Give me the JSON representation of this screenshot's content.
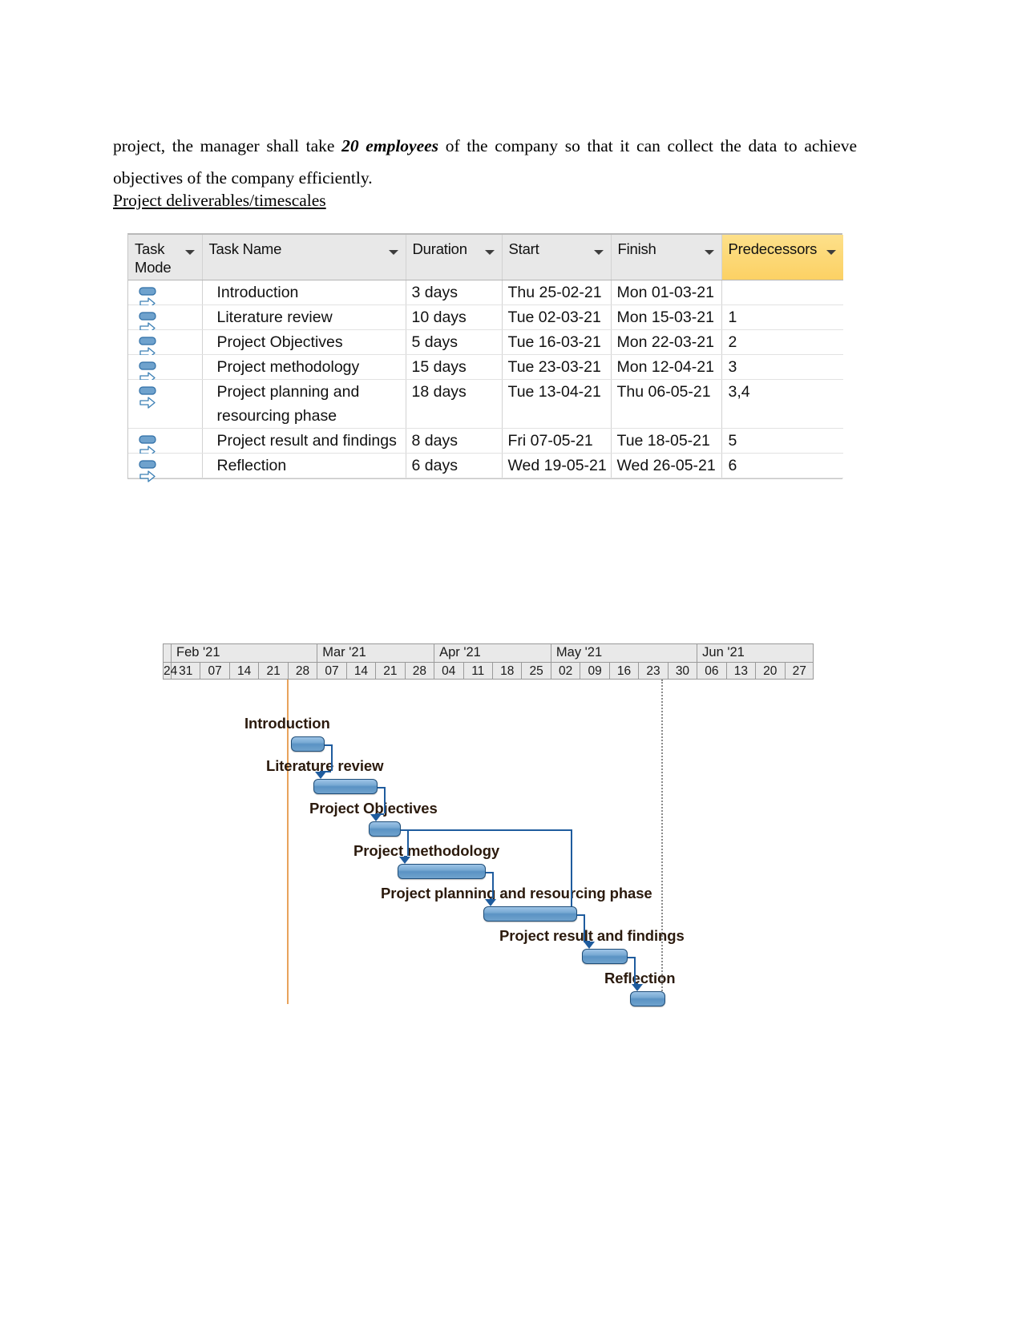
{
  "document": {
    "paragraph_prefix": "project, the manager shall take ",
    "paragraph_bold": "20 employees",
    "paragraph_suffix": " of the company so that it can collect the data to achieve objectives of the company efficiently.",
    "heading": "Project deliverables/timescales"
  },
  "table": {
    "columns": [
      {
        "label": "Task Mode",
        "icon": "chevron-down-icon",
        "highlighted": false
      },
      {
        "label": "Task Name",
        "icon": "chevron-down-icon",
        "highlighted": false
      },
      {
        "label": "Duration",
        "icon": "chevron-down-icon",
        "highlighted": false
      },
      {
        "label": "Start",
        "icon": "chevron-down-icon",
        "highlighted": false
      },
      {
        "label": "Finish",
        "icon": "chevron-down-icon",
        "highlighted": false
      },
      {
        "label": "Predecessors",
        "icon": "chevron-down-icon",
        "highlighted": true
      }
    ],
    "highlight_color": "#fcd164",
    "header_background": "#e8e8e8",
    "rows": [
      {
        "mode_icon": "auto-schedule-icon",
        "name": "Introduction",
        "duration": "3 days",
        "start": "Thu 25-02-21",
        "finish": "Mon 01-03-21",
        "predecessors": ""
      },
      {
        "mode_icon": "auto-schedule-icon",
        "name": "Literature review",
        "duration": "10 days",
        "start": "Tue 02-03-21",
        "finish": "Mon 15-03-21",
        "predecessors": "1"
      },
      {
        "mode_icon": "auto-schedule-icon",
        "name": "Project Objectives",
        "duration": "5 days",
        "start": "Tue 16-03-21",
        "finish": "Mon 22-03-21",
        "predecessors": "2"
      },
      {
        "mode_icon": "auto-schedule-icon",
        "name": "Project methodology",
        "duration": "15 days",
        "start": "Tue 23-03-21",
        "finish": "Mon 12-04-21",
        "predecessors": "3"
      },
      {
        "mode_icon": "auto-schedule-icon",
        "name": "Project planning and resourcing phase",
        "duration": "18 days",
        "start": "Tue 13-04-21",
        "finish": "Thu 06-05-21",
        "predecessors": "3,4"
      },
      {
        "mode_icon": "auto-schedule-icon",
        "name": "Project result and findings",
        "duration": "8 days",
        "start": "Fri 07-05-21",
        "finish": "Tue 18-05-21",
        "predecessors": "5"
      },
      {
        "mode_icon": "auto-schedule-icon",
        "name": "Reflection",
        "duration": "6 days",
        "start": "Wed 19-05-21",
        "finish": "Wed 26-05-21",
        "predecessors": "6"
      }
    ]
  },
  "chart_data": {
    "type": "bar",
    "chart_kind": "gantt",
    "title": "Project deliverables/timescales",
    "xlabel": "",
    "ylabel": "",
    "grid": false,
    "legend": "none",
    "bar_color": "#6fa2cd",
    "bar_outline_color": "#1f4e79",
    "today_line_color": "#e8a35c",
    "months": [
      "Feb '21",
      "Mar '21",
      "Apr '21",
      "May '21",
      "Jun '21"
    ],
    "month_spans": [
      5,
      4,
      4,
      5,
      4
    ],
    "week_ticks": [
      "24",
      "31",
      "07",
      "14",
      "21",
      "28",
      "07",
      "14",
      "21",
      "28",
      "04",
      "11",
      "18",
      "25",
      "02",
      "09",
      "16",
      "23",
      "30",
      "06",
      "13",
      "20",
      "27"
    ],
    "categories": [
      "Introduction",
      "Literature review",
      "Project Objectives",
      "Project methodology",
      "Project planning and resourcing phase",
      "Project result and findings",
      "Reflection"
    ],
    "tasks": [
      {
        "name": "Introduction",
        "start": "Thu 25-02-21",
        "finish": "Mon 01-03-21",
        "duration_days": 3,
        "predecessors": ""
      },
      {
        "name": "Literature review",
        "start": "Tue 02-03-21",
        "finish": "Mon 15-03-21",
        "duration_days": 10,
        "predecessors": "1"
      },
      {
        "name": "Project Objectives",
        "start": "Tue 16-03-21",
        "finish": "Mon 22-03-21",
        "duration_days": 5,
        "predecessors": "2"
      },
      {
        "name": "Project methodology",
        "start": "Tue 23-03-21",
        "finish": "Mon 12-04-21",
        "duration_days": 15,
        "predecessors": "3"
      },
      {
        "name": "Project planning and resourcing phase",
        "start": "Tue 13-04-21",
        "finish": "Thu 06-05-21",
        "duration_days": 18,
        "predecessors": "3,4"
      },
      {
        "name": "Project result and findings",
        "start": "Fri 07-05-21",
        "finish": "Tue 18-05-21",
        "duration_days": 8,
        "predecessors": "5"
      },
      {
        "name": "Reflection",
        "start": "Wed 19-05-21",
        "finish": "Wed 26-05-21",
        "duration_days": 6,
        "predecessors": "6"
      }
    ]
  }
}
